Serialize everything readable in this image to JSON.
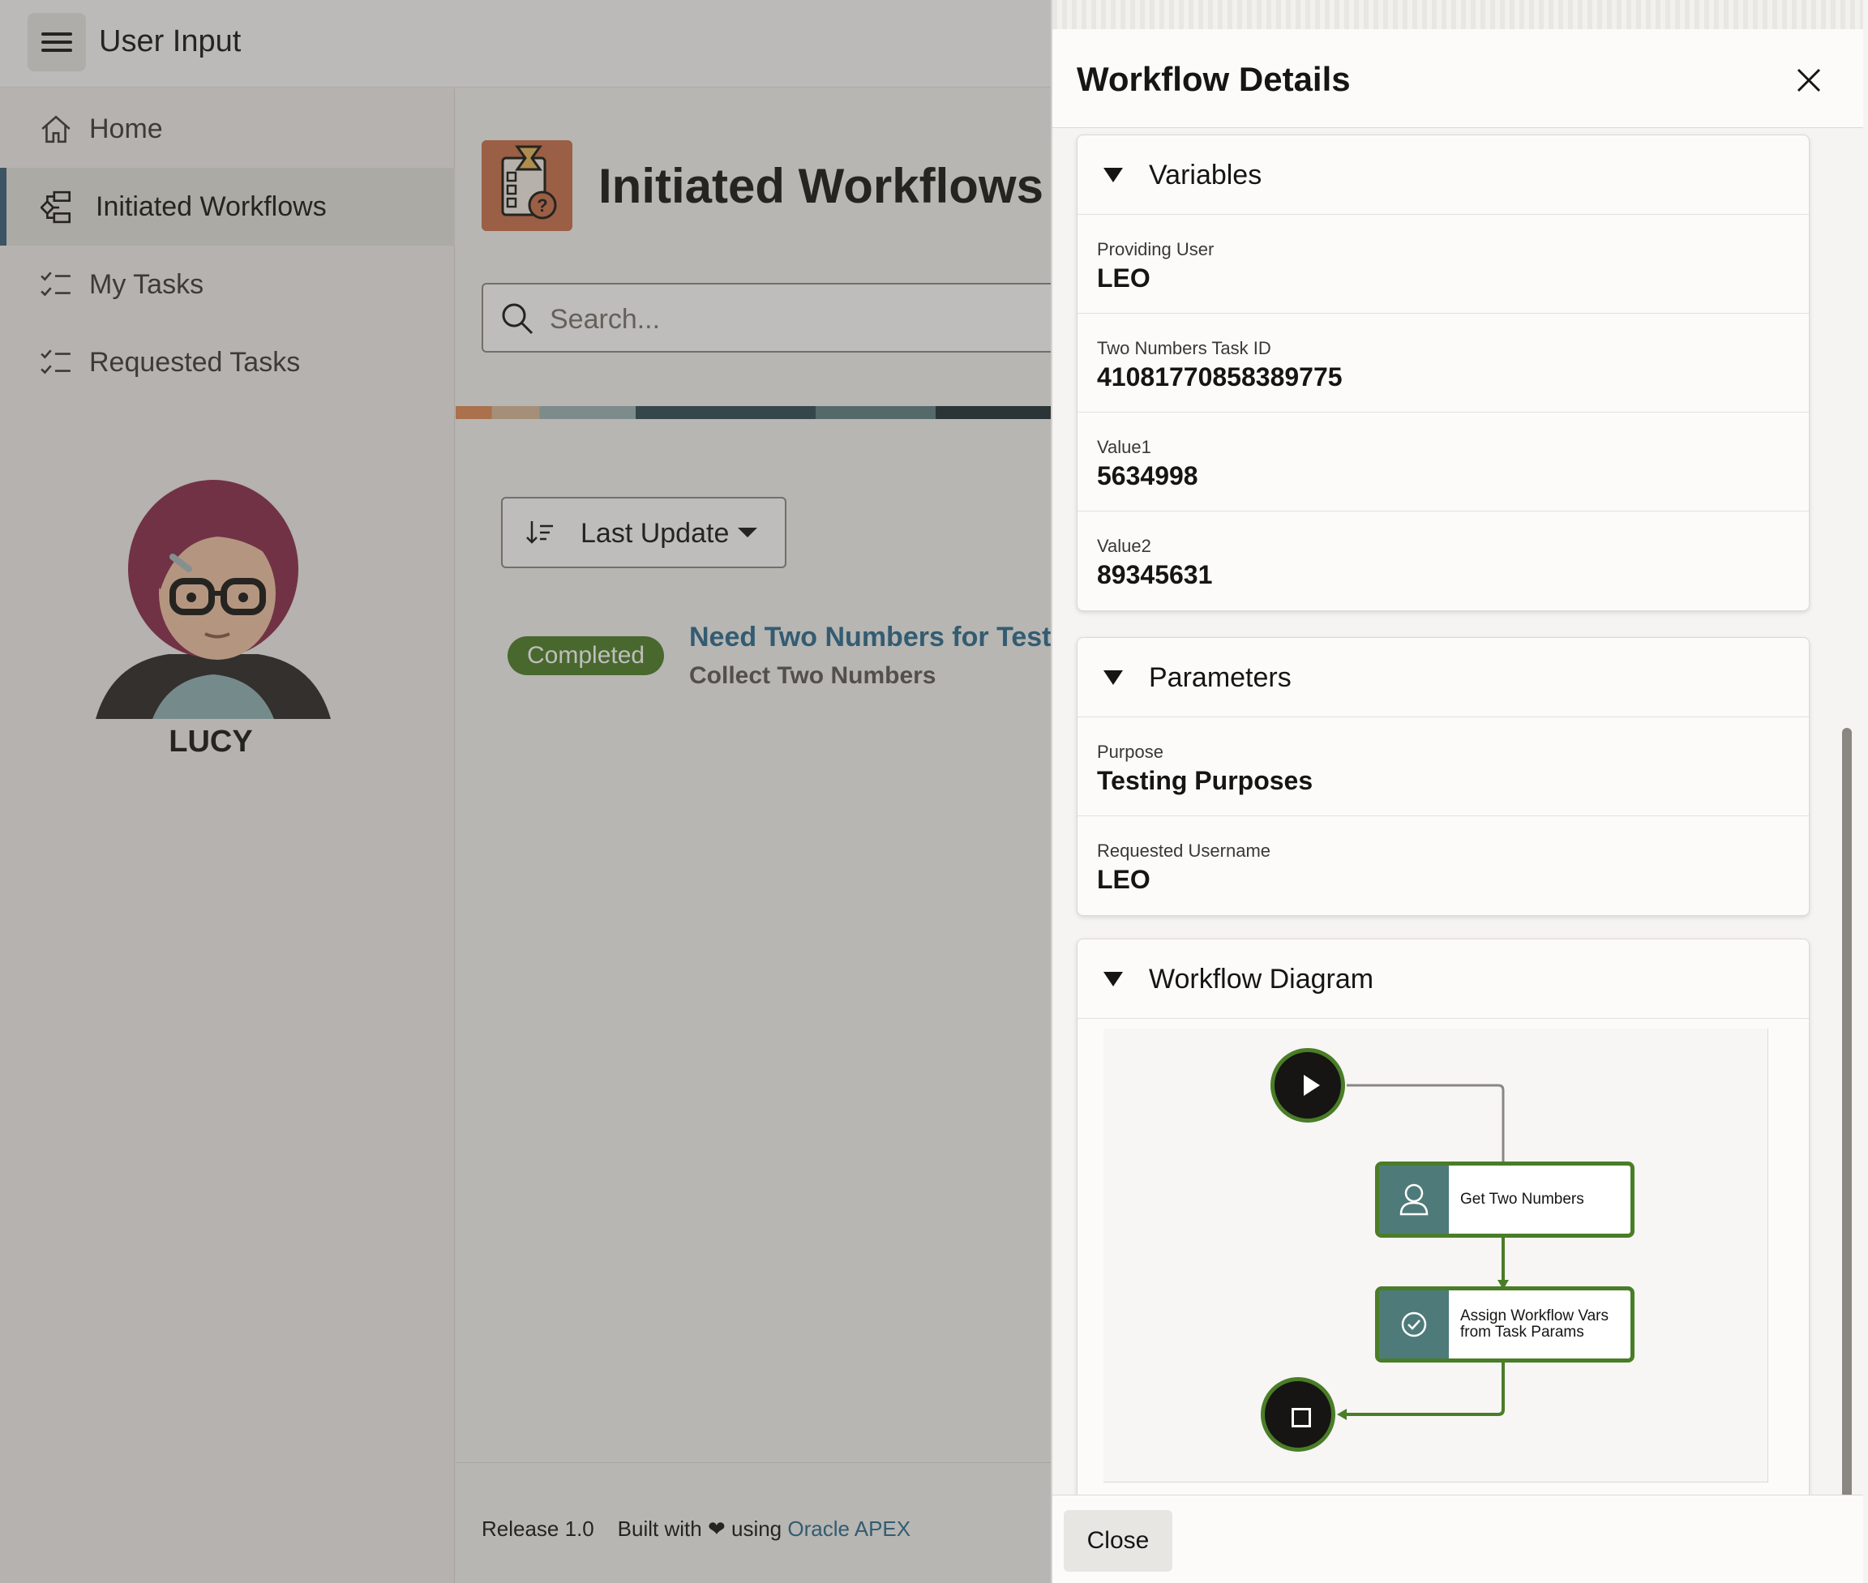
{
  "app": {
    "title": "User Input"
  },
  "sidebar": {
    "items": [
      {
        "label": "Home",
        "icon": "home-icon"
      },
      {
        "label": "Initiated Workflows",
        "icon": "workflow-icon",
        "active": true
      },
      {
        "label": "My Tasks",
        "icon": "tasks-icon"
      },
      {
        "label": "Requested Tasks",
        "icon": "tasks-icon"
      }
    ],
    "user": {
      "name": "LUCY"
    }
  },
  "main": {
    "page_title": "Initiated Workflows",
    "search": {
      "placeholder": "Search..."
    },
    "sort": {
      "label": "Last Update"
    },
    "list": [
      {
        "status": "Completed",
        "title": "Need Two Numbers for Testin",
        "subtitle": "Collect Two Numbers"
      }
    ],
    "footer": {
      "release": "Release 1.0",
      "built_with": "Built with",
      "using": "using",
      "link": "Oracle APEX"
    }
  },
  "drawer": {
    "title": "Workflow Details",
    "close_label": "Close",
    "variables": {
      "title": "Variables",
      "fields": [
        {
          "label": "Providing User",
          "value": "LEO"
        },
        {
          "label": "Two Numbers Task ID",
          "value": "41081770858389775"
        },
        {
          "label": "Value1",
          "value": "5634998"
        },
        {
          "label": "Value2",
          "value": "89345631"
        }
      ]
    },
    "parameters": {
      "title": "Parameters",
      "fields": [
        {
          "label": "Purpose",
          "value": "Testing Purposes"
        },
        {
          "label": "Requested Username",
          "value": "LEO"
        }
      ]
    },
    "diagram": {
      "title": "Workflow Diagram",
      "nodes": [
        {
          "type": "start"
        },
        {
          "type": "task",
          "label": "Get Two Numbers",
          "icon": "user-icon"
        },
        {
          "type": "task",
          "label_line1": "Assign Workflow Vars",
          "label_line2": "from Task Params",
          "icon": "check-circle-icon"
        },
        {
          "type": "end"
        }
      ]
    }
  },
  "colors": {
    "accent": "#2a6a8f",
    "status_completed": "#4a7d27",
    "nav_active_bar": "#3a5f7a",
    "task_icon_bg": "#4e7b7a"
  }
}
